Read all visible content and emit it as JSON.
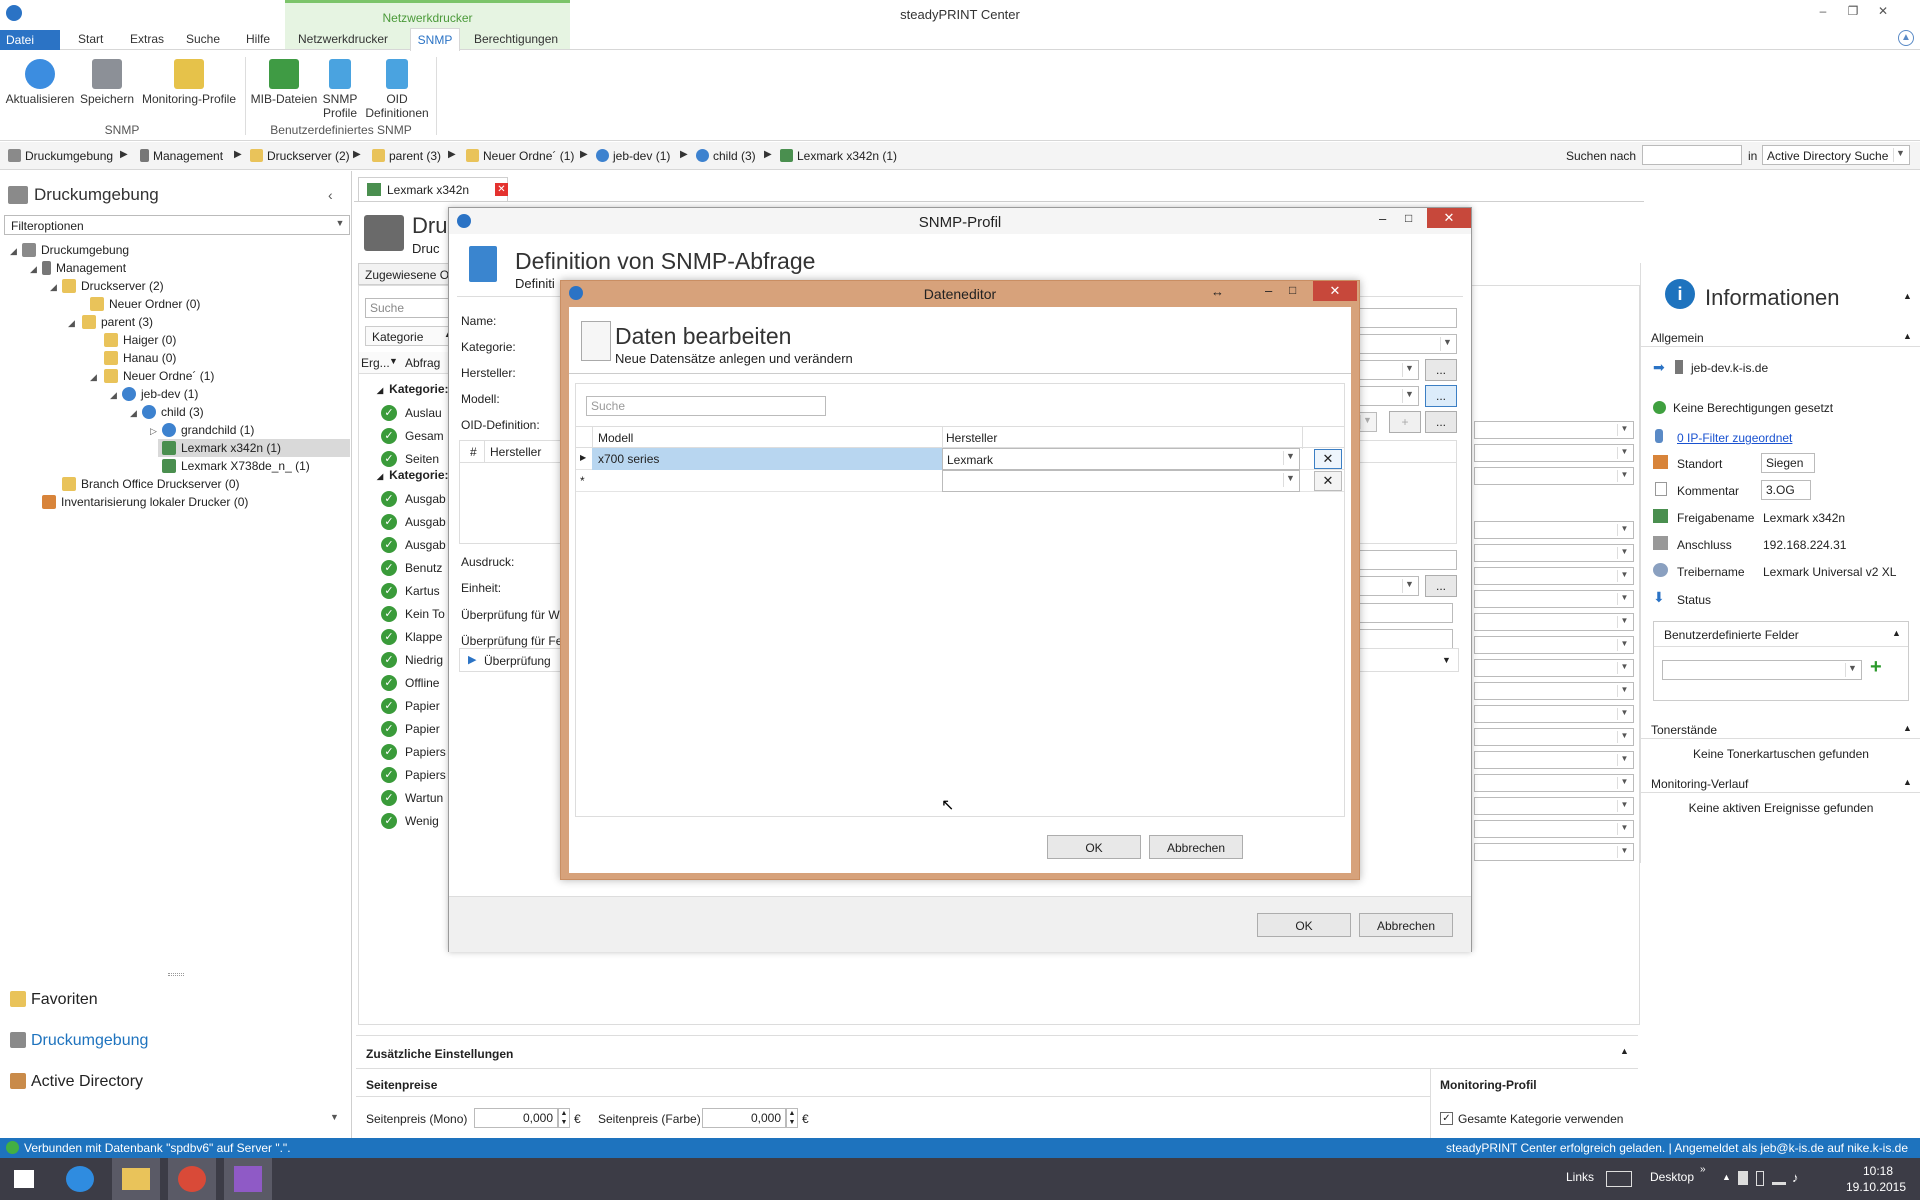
{
  "app": {
    "title": "steadyPRINT Center",
    "context_group": "Netzwerkdrucker"
  },
  "ribbon": {
    "tabs": [
      "Datei",
      "Start",
      "Extras",
      "Suche",
      "Hilfe",
      "Netzwerkdrucker",
      "SNMP",
      "Berechtigungen"
    ],
    "buttons": {
      "aktualisieren": "Aktualisieren",
      "speichern": "Speichern",
      "monitoring": "Monitoring-Profile",
      "mib": "MIB-Dateien",
      "snmp_profile_1": "SNMP",
      "snmp_profile_2": "Profile",
      "oid_1": "OID",
      "oid_2": "Definitionen"
    },
    "group_snmp": "SNMP",
    "group_custom": "Benutzerdefiniertes SNMP"
  },
  "breadcrumb": {
    "items": [
      "Druckumgebung",
      "Management",
      "Druckserver (2)",
      "parent (3)",
      "Neuer Ordne´ (1)",
      "jeb-dev (1)",
      "child (3)",
      "Lexmark x342n (1)"
    ],
    "search_label": "Suchen nach",
    "in_label": "in",
    "search_scope": "Active Directory Suche"
  },
  "left": {
    "title": "Druckumgebung",
    "filter": "Filteroptionen",
    "tree": [
      "Druckumgebung",
      "Management",
      "Druckserver (2)",
      "Neuer Ordner (0)",
      "parent (3)",
      "Haiger (0)",
      "Hanau (0)",
      "Neuer Ordne´ (1)",
      "jeb-dev (1)",
      "child (3)",
      "grandchild (1)",
      "Lexmark x342n (1)",
      "Lexmark X738de_n_ (1)",
      "Branch Office Druckserver (0)",
      "Inventarisierung lokaler Drucker (0)"
    ],
    "nav": [
      "Favoriten",
      "Druckumgebung",
      "Active Directory"
    ]
  },
  "main": {
    "doc_tab": "Lexmark x342n",
    "heading": "Dru",
    "subheading": "Druc",
    "assigned_tab": "Zugewiesene O",
    "search_placeholder": "Suche",
    "category_label": "Kategorie",
    "col_erg": "Erg...",
    "col_abfrage": "Abfrag",
    "category_group": "Kategorie:",
    "rows_a": [
      "Auslau",
      "Gesam",
      "Seiten"
    ],
    "rows_b": [
      "Ausgab",
      "Ausgab",
      "Ausgab",
      "Benutz",
      "Kartus",
      "Kein To",
      "Klappe",
      "Niedrig",
      "Offline",
      "Papier",
      "Papier",
      "Papiers",
      "Papiers",
      "Wartun",
      "Wenig"
    ],
    "extra": {
      "title": "Zusätzliche Einstellungen",
      "seitenpreise": "Seitenpreise",
      "mono_label": "Seitenpreis (Mono)",
      "mono_value": "0,000",
      "farbe_label": "Seitenpreis (Farbe)",
      "farbe_value": "0,000",
      "currency": "€",
      "monitoring_title": "Monitoring-Profil",
      "gesamte": "Gesamte Kategorie verwenden"
    }
  },
  "info": {
    "title": "Informationen",
    "allgemein": "Allgemein",
    "host": "jeb-dev.k-is.de",
    "perm": "Keine Berechtigungen gesetzt",
    "ipfilter": "0 IP-Filter zugeordnet",
    "standort_label": "Standort",
    "standort_value": "Siegen",
    "kommentar_label": "Kommentar",
    "kommentar_value": "3.OG",
    "freigabe_label": "Freigabename",
    "freigabe_value": "Lexmark x342n",
    "anschluss_label": "Anschluss",
    "anschluss_value": "192.168.224.31",
    "treiber_label": "Treibername",
    "treiber_value": "Lexmark Universal v2 XL",
    "status_label": "Status",
    "custom_fields": "Benutzerdefinierte Felder",
    "toner_title": "Tonerstände",
    "toner_empty": "Keine Tonerkartuschen gefunden",
    "monitoring_title": "Monitoring-Verlauf",
    "monitoring_empty": "Keine aktiven Ereignisse gefunden"
  },
  "snmp_dialog": {
    "title": "SNMP-Profil",
    "heading": "Definition von SNMP-Abfrage",
    "subheading": "Definiti",
    "name_label": "Name:",
    "kategorie_label": "Kategorie:",
    "hersteller_label": "Hersteller:",
    "modell_label": "Modell:",
    "oid_label": "OID-Definition:",
    "grid_hash": "#",
    "grid_hersteller": "Hersteller",
    "ausdruck_label": "Ausdruck:",
    "einheit_label": "Einheit:",
    "check_w": "Überprüfung für W",
    "check_f": "Überprüfung für Fe",
    "check_expander": "Überprüfung",
    "ellipsis": "...",
    "plus": "+",
    "ok": "OK",
    "cancel": "Abbrechen"
  },
  "data_editor": {
    "title": "Dateneditor",
    "heading": "Daten bearbeiten",
    "subheading": "Neue Datensätze anlegen und verändern",
    "search_placeholder": "Suche",
    "col_modell": "Modell",
    "col_hersteller": "Hersteller",
    "rows": [
      {
        "modell": "x700 series",
        "hersteller": "Lexmark"
      }
    ],
    "new_row_marker": "*",
    "ok": "OK",
    "cancel": "Abbrechen"
  },
  "statusbar": {
    "left": "Verbunden mit Datenbank \"spdbv6\" auf Server \".\".",
    "right": "steadyPRINT Center erfolgreich geladen. | Angemeldet als jeb@k-is.de auf nike.k-is.de"
  },
  "taskbar": {
    "links": "Links",
    "desktop": "Desktop",
    "time": "10:18",
    "date": "19.10.2015"
  },
  "colors": {
    "accent": "#1e73be",
    "ctx_green": "#7cc46a",
    "dialog_border": "#c98e63",
    "selection": "#b8d6f0"
  }
}
